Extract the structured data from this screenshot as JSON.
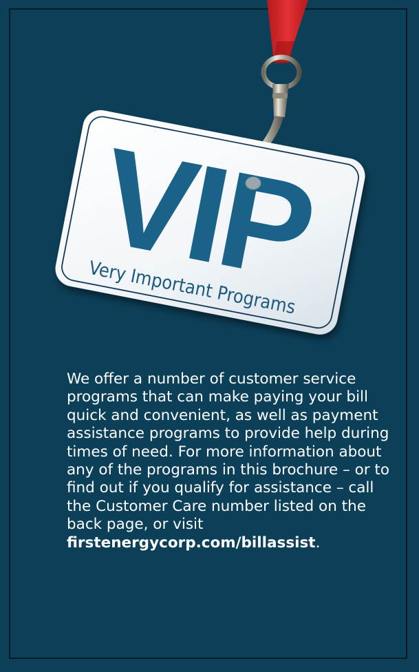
{
  "badge": {
    "title": "VIP",
    "subtitle": "Very Important Programs"
  },
  "intro": {
    "text": "We offer a number of customer service programs that can make paying your bill quick and convenient, as well as payment assistance programs to provide help during times of need. For more information about any of the programs in this brochure – or to find out if you qualify for assistance – call the Customer Care number listed on the back page, or visit ",
    "link": "firstenergycorp.com/billassist",
    "end": "."
  },
  "colors": {
    "background": "#0c3f58",
    "title": "#1a6287",
    "lanyard": "#e0262a",
    "card": "#f4f8fb"
  }
}
